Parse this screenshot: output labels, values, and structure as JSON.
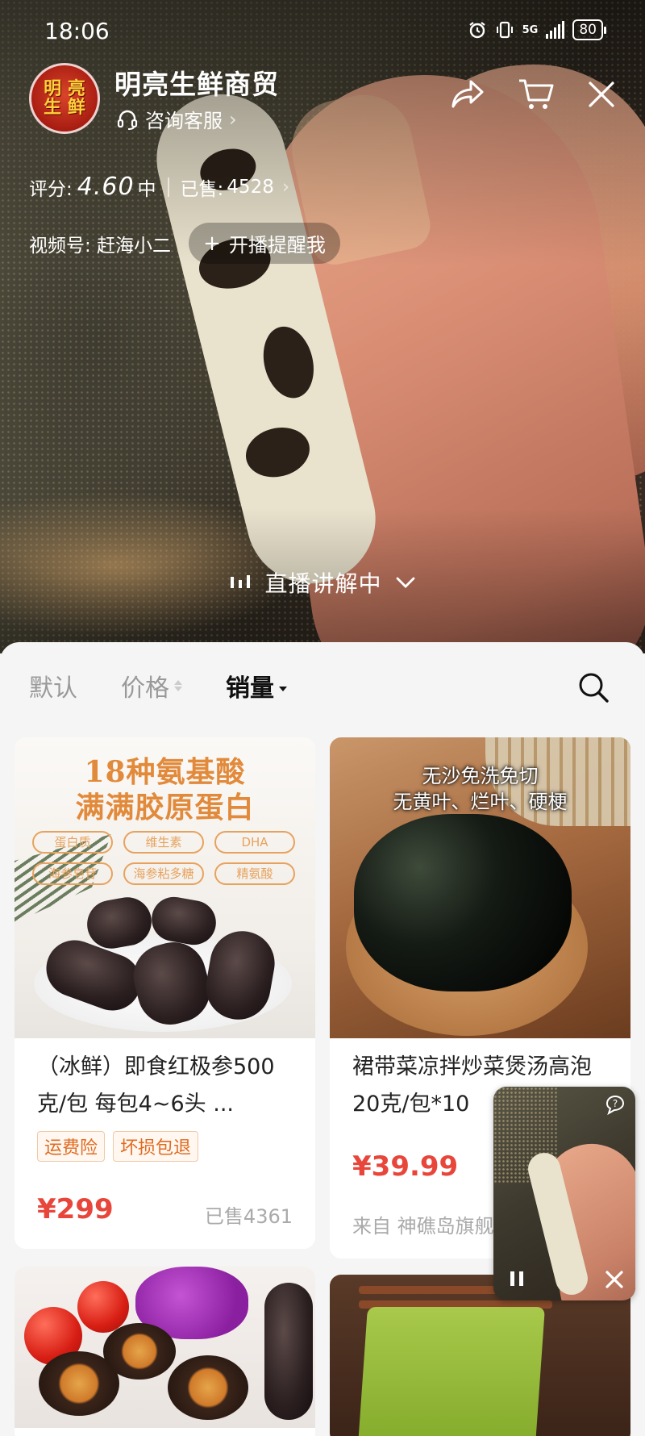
{
  "status_bar": {
    "time": "18:06",
    "network": "5G",
    "battery": "80"
  },
  "shop": {
    "name": "明亮生鲜商贸",
    "avatar_text": "明 亮\n生 鲜",
    "consult_label": "咨询客服",
    "rating_label": "评分:",
    "rating_value": "4.60",
    "rating_level": "中",
    "sold_label": "已售:",
    "sold_count": "4528",
    "video_account": "视频号: 赶海小二",
    "remind_label": "开播提醒我",
    "live_label": "直播讲解中"
  },
  "icons": {
    "share": "share-icon",
    "cart": "cart-icon",
    "close": "close-icon",
    "headset": "headset-icon",
    "search": "search-icon"
  },
  "sort_tabs": [
    {
      "label": "默认",
      "active": false
    },
    {
      "label": "价格",
      "active": false
    },
    {
      "label": "销量",
      "active": true
    }
  ],
  "products": [
    {
      "image_heading_1": "18种氨基酸",
      "image_heading_2": "满满胶原蛋白",
      "image_pills": [
        "蛋白质",
        "维生素",
        "DHA",
        "海参皂苷",
        "海参粘多糖",
        "精氨酸"
      ],
      "title": "（冰鲜）即食红极参500克/包 每包4~6头 ...",
      "tags": [
        "运费险",
        "坏损包退"
      ],
      "price": "¥299",
      "sold": "已售4361"
    },
    {
      "image_caption_1": "无沙免洗免切",
      "image_caption_2": "无黄叶、烂叶、硬梗",
      "title": "裙带菜凉拌炒菜煲汤高泡20克/包*10",
      "price": "¥39.99",
      "from": "来自 神礁岛旗舰店"
    }
  ],
  "colors": {
    "price_red": "#e8463a",
    "tag_orange": "#e06b20",
    "background": "#f5f5f5"
  }
}
